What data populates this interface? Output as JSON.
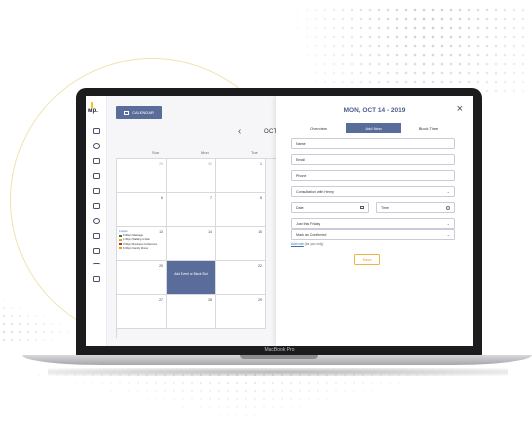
{
  "sidebar": {
    "logo": "ᴍp."
  },
  "calendar": {
    "button_label": "CALENDAR",
    "month": "OCTO",
    "weekdays": [
      "Sun",
      "Mon",
      "Tue"
    ],
    "week_numbers": [
      [
        "29",
        "30",
        "1"
      ],
      [
        "6",
        "7",
        "8"
      ],
      [
        "13",
        "14",
        "15"
      ],
      [
        "20",
        "21",
        "22"
      ],
      [
        "27",
        "28",
        "29"
      ]
    ],
    "event_header": "4 Appts",
    "events": [
      {
        "text": "6:30am Massage",
        "color": "#2e7d32"
      },
      {
        "text": "1:30pm Walking to Dan",
        "color": "#f2a018"
      },
      {
        "text": "3:30pm Business Conference",
        "color": "#c62828"
      },
      {
        "text": "6:30pm Family Dinner",
        "color": "#f2a018"
      }
    ],
    "add_event_label": "Add Event or Block Slot"
  },
  "panel": {
    "title": "MON, OCT 14 - 2019",
    "tabs": [
      "Overview",
      "Add New",
      "Block Time"
    ],
    "name_placeholder": "Name",
    "email_placeholder": "Email",
    "phone_placeholder": "Phone",
    "service_value": "Consultation with Henry",
    "date_placeholder": "Date",
    "time_placeholder": "Time",
    "repeat_value": "Just this Friday",
    "status_value": "Mark as Confirmed",
    "note_link": "Add note",
    "note_suffix": " (for you only)",
    "save_label": "Save"
  },
  "laptop": {
    "brand": "MacBook Pro"
  }
}
